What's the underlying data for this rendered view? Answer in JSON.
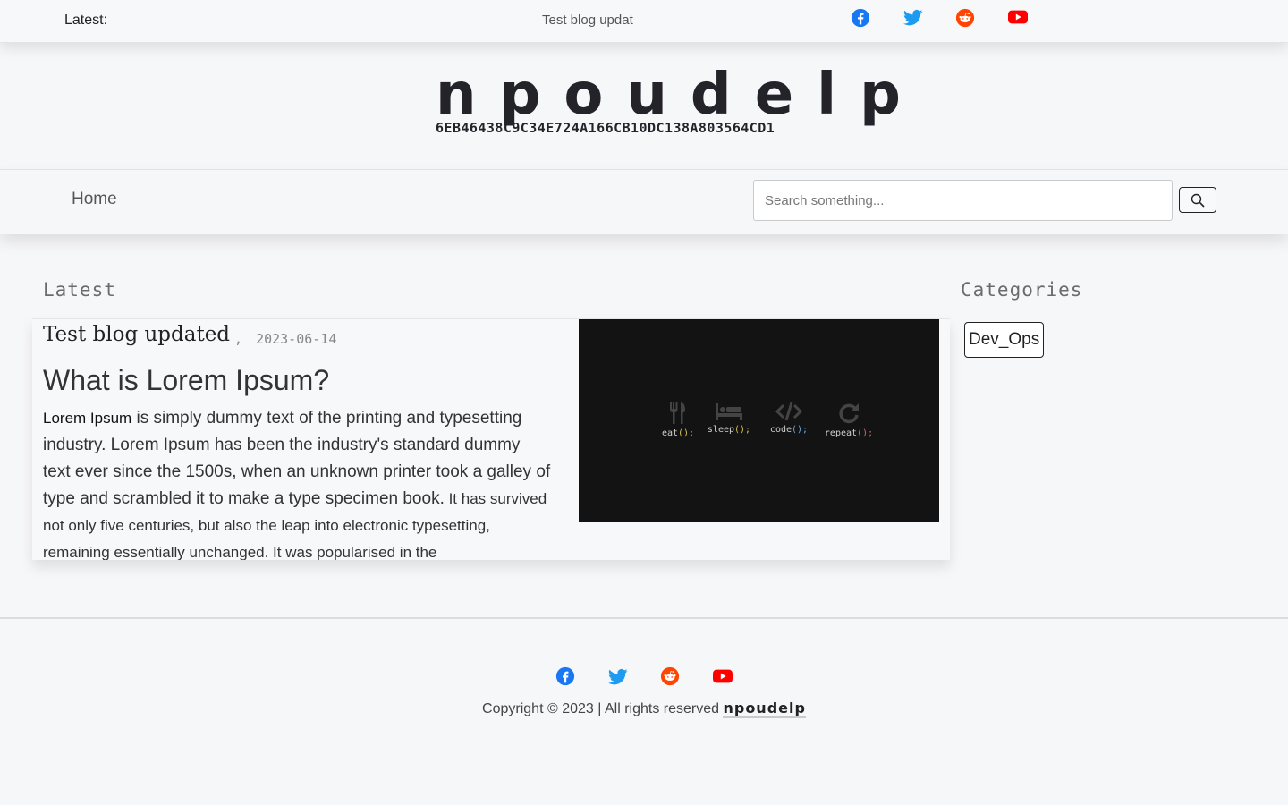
{
  "topbar": {
    "latest_label": "Latest:",
    "ticker_text": "Test blog updated",
    "social": [
      {
        "icon": "facebook-icon",
        "color": "#1877f2"
      },
      {
        "icon": "twitter-icon",
        "color": "#1d9bf0"
      },
      {
        "icon": "reddit-icon",
        "color": "#ff4500"
      },
      {
        "icon": "youtube-icon",
        "color": "#ff0000"
      }
    ]
  },
  "header": {
    "brand": "npoudelp",
    "hash": "6EB46438C9C34E724A166CB10DC138A803564CD1"
  },
  "nav": {
    "home_label": "Home",
    "search_placeholder": "Search something..."
  },
  "main": {
    "latest_title": "Latest",
    "post": {
      "title": "Test blog updated",
      "date_prefix": ",",
      "date": "2023-06-14",
      "heading": "What is Lorem Ipsum?",
      "body_strong": "Lorem Ipsum",
      "body_part1": " is simply dummy text of the printing and typesetting industry. Lorem Ipsum has been the industry's standard dummy text ever since the 1500s, when an unknown printer took a galley of type and scrambled it to make a type specimen book.",
      "body_part2": " It has survived not only five centuries, but also the leap into electronic typesetting, remaining essentially unchanged. It was popularised in the",
      "image_items": [
        {
          "icon": "fork-knife-icon",
          "word": "eat",
          "paren": "();"
        },
        {
          "icon": "bed-icon",
          "word": "sleep",
          "paren": "();"
        },
        {
          "icon": "code-icon",
          "word": "code",
          "paren": "();"
        },
        {
          "icon": "redo-icon",
          "word": "repeat",
          "paren": "();"
        }
      ]
    }
  },
  "sidebar": {
    "categories_title": "Categories",
    "categories": [
      "Dev_Ops"
    ]
  },
  "footer": {
    "copyright_text": "Copyright © 2023 | All rights reserved",
    "brand": "npoudelp"
  }
}
